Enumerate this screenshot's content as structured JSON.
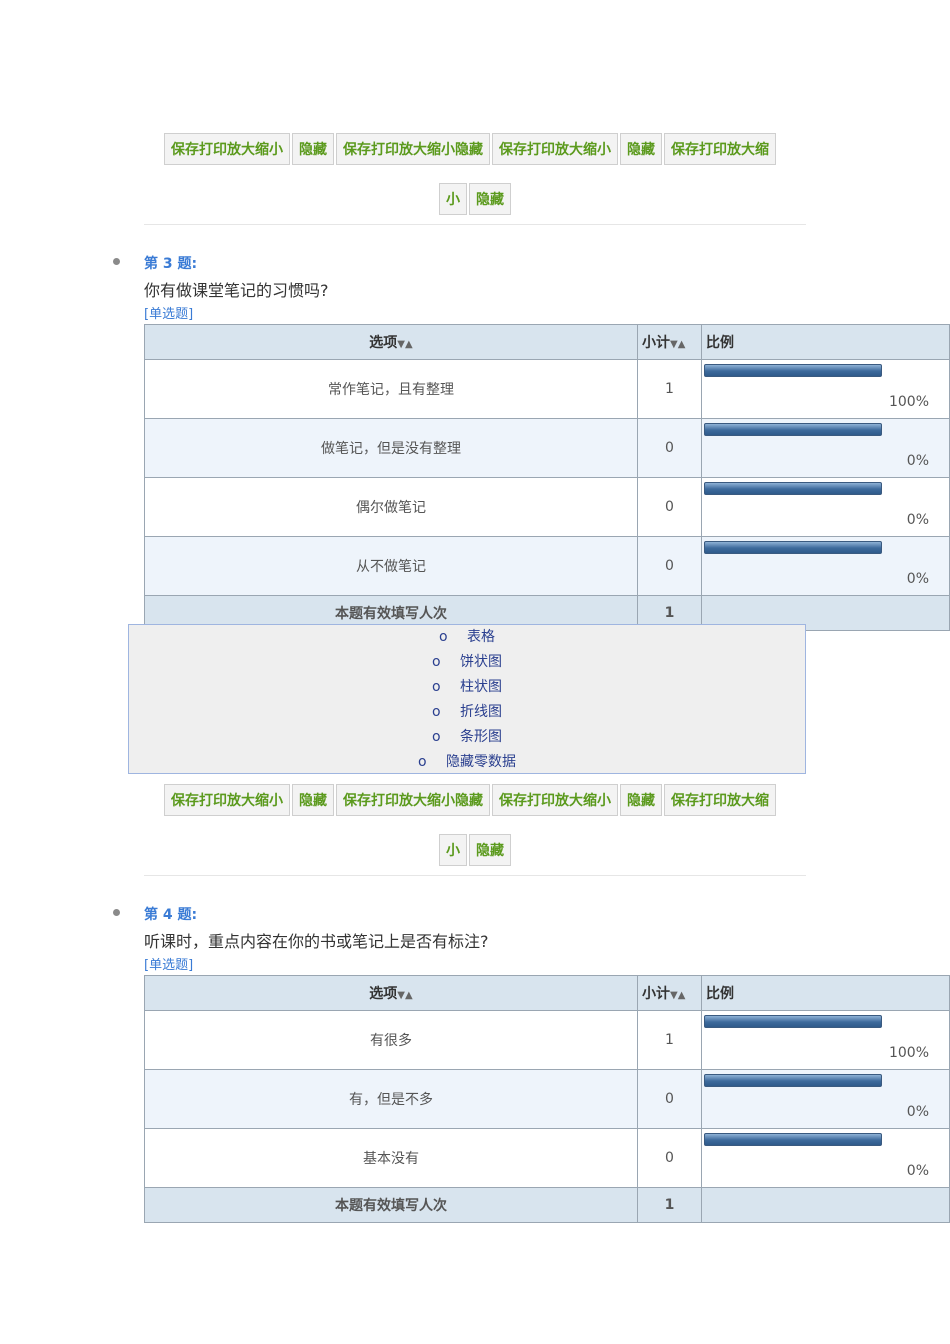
{
  "toolbar_main": [
    "保存打印放大缩小",
    "隐藏",
    "保存打印放大缩小隐藏",
    "保存打印放大缩小",
    "隐藏",
    "保存打印放大缩"
  ],
  "toolbar_sub": [
    "小",
    "隐藏"
  ],
  "questions": [
    {
      "number": "第 3 题:",
      "text": "你有做课堂笔记的习惯吗?",
      "type": "[单选题]",
      "headers": {
        "option": "选项",
        "count": "小计",
        "percent": "比例"
      },
      "rows": [
        {
          "option": "常作笔记，且有整理",
          "count": "1",
          "percent": "100%",
          "value": 100
        },
        {
          "option": "做笔记，但是没有整理",
          "count": "0",
          "percent": "0%",
          "value": 0
        },
        {
          "option": "偶尔做笔记",
          "count": "0",
          "percent": "0%",
          "value": 0
        },
        {
          "option": "从不做笔记",
          "count": "0",
          "percent": "0%",
          "value": 0
        }
      ],
      "summary": {
        "label": "本题有效填写人次",
        "count": "1"
      }
    },
    {
      "number": "第 4 题:",
      "text": "听课时，重点内容在你的书或笔记上是否有标注?",
      "type": "[单选题]",
      "headers": {
        "option": "选项",
        "count": "小计",
        "percent": "比例"
      },
      "rows": [
        {
          "option": "有很多",
          "count": "1",
          "percent": "100%",
          "value": 100
        },
        {
          "option": "有，但是不多",
          "count": "0",
          "percent": "0%",
          "value": 0
        },
        {
          "option": "基本没有",
          "count": "0",
          "percent": "0%",
          "value": 0
        }
      ],
      "summary": {
        "label": "本题有效填写人次",
        "count": "1"
      }
    }
  ],
  "chart_options": {
    "bullet": "o",
    "items": [
      "表格",
      "饼状图",
      "柱状图",
      "折线图",
      "条形图",
      "隐藏零数据"
    ]
  }
}
